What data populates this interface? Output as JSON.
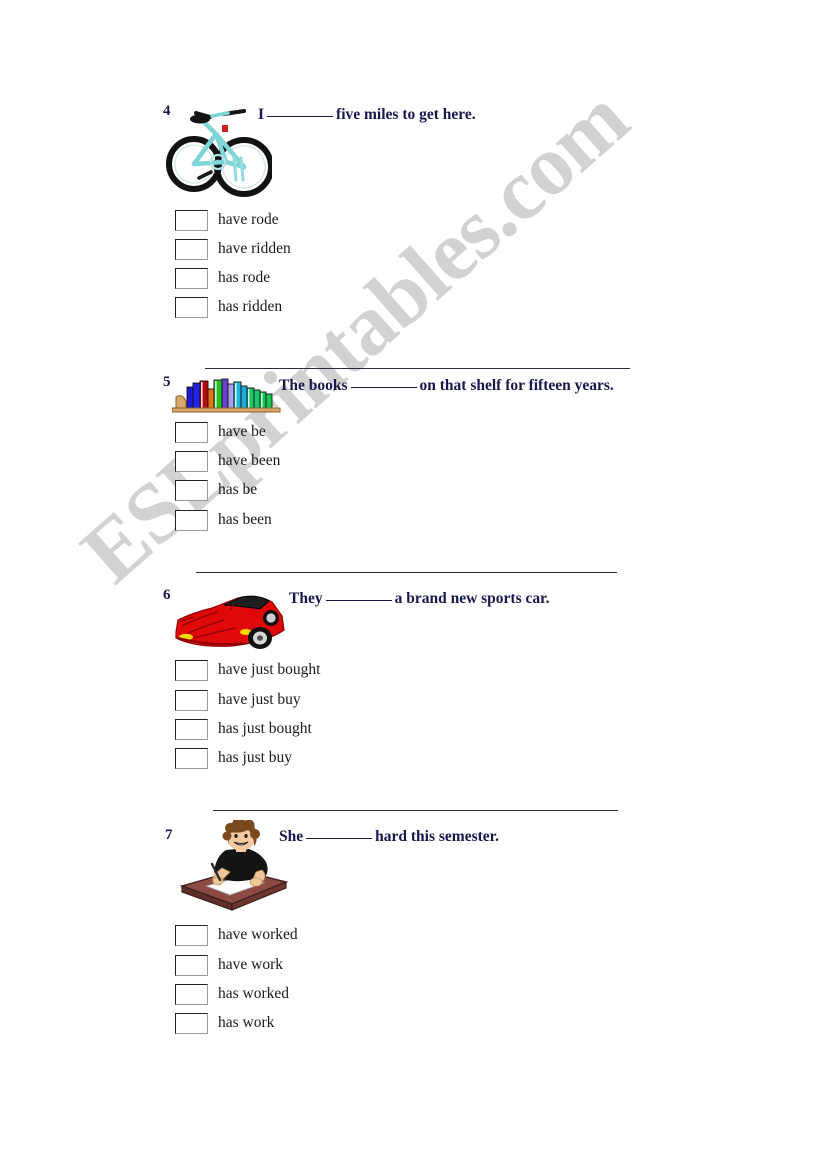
{
  "worksheet": {
    "questions": [
      {
        "number": "4",
        "sentence_before": "I",
        "sentence_after": "five miles to get here.",
        "image": "bicycle-illustration",
        "options": [
          "have rode",
          "have ridden",
          "has rode",
          "has ridden"
        ]
      },
      {
        "number": "5",
        "sentence_before": "The books",
        "sentence_after": "on that shelf for fifteen years.",
        "image": "bookshelf-illustration",
        "options": [
          "have be",
          "have been",
          "has be",
          "has been"
        ]
      },
      {
        "number": "6",
        "sentence_before": "They",
        "sentence_after": "a brand new sports car.",
        "image": "red-sports-car-illustration",
        "options": [
          "have just bought",
          "have just buy",
          "has just bought",
          "has just buy"
        ]
      },
      {
        "number": "7",
        "sentence_before": "She",
        "sentence_after": "hard this semester.",
        "image": "student-writing-at-desk-illustration",
        "options": [
          "have worked",
          "have work",
          "has worked",
          "has work"
        ]
      }
    ]
  },
  "watermark": {
    "text": "ESLprintables.com",
    "color": "#d2d2d2"
  },
  "colors": {
    "question_text": "#18184e",
    "option_text": "#1a1a1a",
    "divider": "#2b2b3d",
    "page_background": "#ffffff"
  }
}
